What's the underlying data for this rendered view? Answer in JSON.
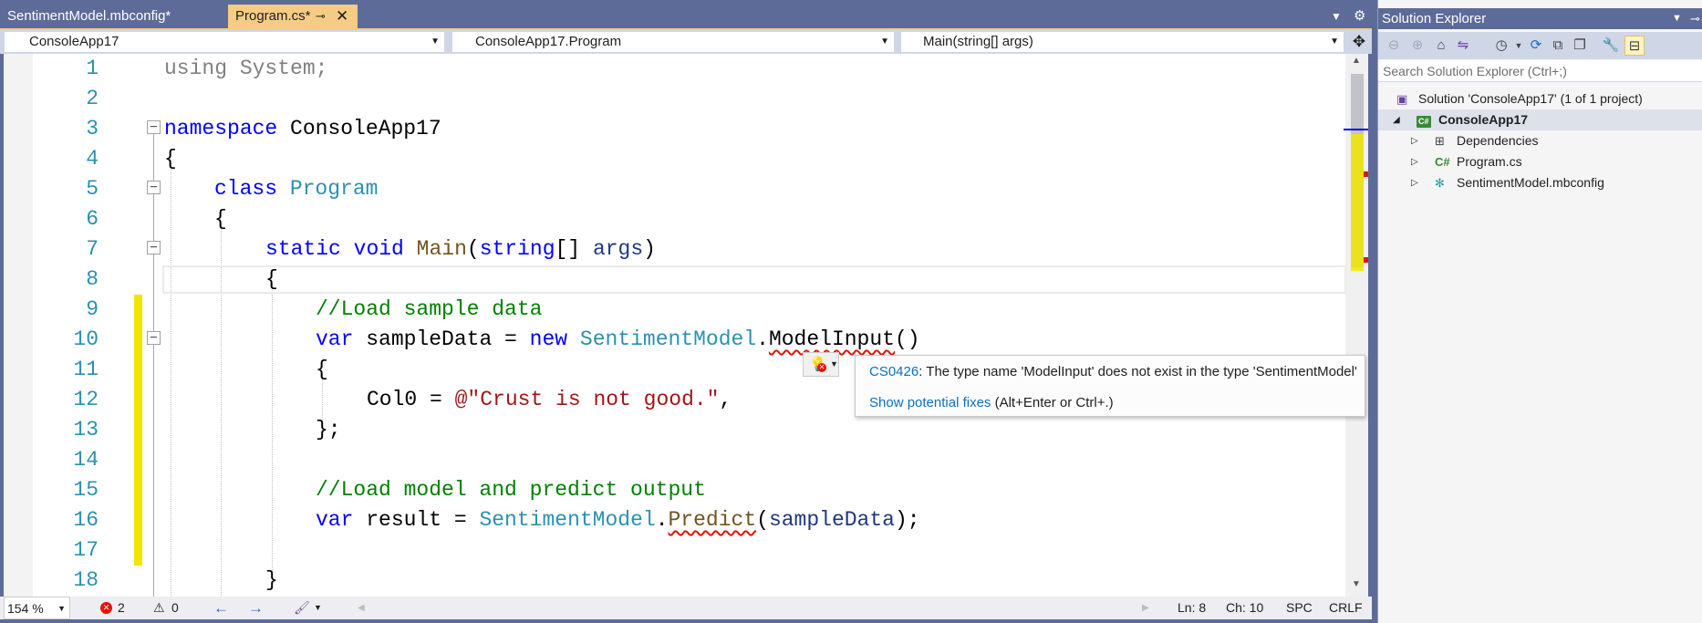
{
  "tabs": [
    {
      "label": "SentimentModel.mbconfig*",
      "active": false
    },
    {
      "label": "Program.cs*",
      "active": true
    }
  ],
  "tab_icons": {
    "pin": "pin-icon",
    "close": "close-icon",
    "overflow": "dropdown-icon",
    "settings": "gear-icon"
  },
  "nav": {
    "project": "ConsoleApp17",
    "class": "ConsoleApp17.Program",
    "member": "Main(string[] args)"
  },
  "code_lines": [
    {
      "num": "1"
    },
    {
      "num": "2"
    },
    {
      "num": "3"
    },
    {
      "num": "4"
    },
    {
      "num": "5"
    },
    {
      "num": "6"
    },
    {
      "num": "7"
    },
    {
      "num": "8"
    },
    {
      "num": "9"
    },
    {
      "num": "10"
    },
    {
      "num": "11"
    },
    {
      "num": "12"
    },
    {
      "num": "13"
    },
    {
      "num": "14"
    },
    {
      "num": "15"
    },
    {
      "num": "16"
    },
    {
      "num": "17"
    },
    {
      "num": "18"
    }
  ],
  "code": {
    "l1_kw": "using",
    "l1_rest": " System;",
    "l3_kw": "namespace",
    "l3_name": " ConsoleApp17",
    "l4": "{",
    "l5_kw": "class",
    "l5_name": "Program",
    "l6": "{",
    "l7_static": "static",
    "l7_void": "void",
    "l7_method": "Main",
    "l7_p1": "(",
    "l7_string": "string",
    "l7_p2": "[] ",
    "l7_args": "args",
    "l7_p3": ")",
    "l8": "{",
    "l9": "//Load sample data",
    "l10_var": "var",
    "l10_name": " sampleData = ",
    "l10_new": "new",
    "l10_sp": " ",
    "l10_type": "SentimentModel",
    "l10_dot": ".",
    "l10_err": "ModelInput",
    "l10_end": "()",
    "l11": "{",
    "l12_prop": "Col0 = ",
    "l12_str": "@\"Crust is not good.\"",
    "l12_end": ",",
    "l13": "};",
    "l15": "//Load model and predict output",
    "l16_var": "var",
    "l16_name": " result = ",
    "l16_type": "SentimentModel",
    "l16_dot": ".",
    "l16_err": "Predict",
    "l16_p1": "(",
    "l16_arg": "sampleData",
    "l16_end": ");",
    "l18": "}"
  },
  "error_tooltip": {
    "code": "CS0426",
    "message": ": The type name 'ModelInput' does not exist in the type 'SentimentModel'",
    "fix_link": "Show potential fixes",
    "fix_shortcut": " (Alt+Enter or Ctrl+.)"
  },
  "status": {
    "zoom": "154 %",
    "errors": "2",
    "warnings": "0",
    "line": "Ln: 8",
    "col": "Ch: 10",
    "ins": "SPC",
    "eol": "CRLF"
  },
  "solution_explorer": {
    "title": "Solution Explorer",
    "search_placeholder": "Search Solution Explorer (Ctrl+;)",
    "solution": "Solution 'ConsoleApp17' (1 of 1 project)",
    "project": "ConsoleApp17",
    "items": [
      {
        "label": "Dependencies",
        "icon": "dependencies-icon"
      },
      {
        "label": "Program.cs",
        "icon": "csharp-file-icon"
      },
      {
        "label": "SentimentModel.mbconfig",
        "icon": "mbconfig-icon"
      }
    ]
  },
  "colors": {
    "chrome": "#5d6b99",
    "active_tab": "#f5cc84",
    "keyword": "#0000ff",
    "type": "#2b91af",
    "comment": "#008000",
    "string": "#a31515",
    "error": "#e51400",
    "change_marker": "#f2e600"
  }
}
